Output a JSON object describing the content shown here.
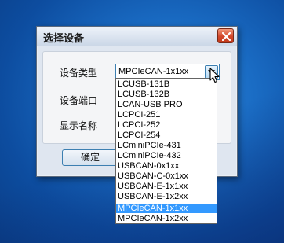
{
  "dialog": {
    "title": "选择设备",
    "fields": {
      "device_type_label": "设备类型",
      "device_port_label": "设备端口",
      "display_name_label": "显示名称"
    },
    "device_type": {
      "value": "MPCIeCAN-1x1xx",
      "options": [
        "LCUSB-131B",
        "LCUSB-132B",
        "LCAN-USB PRO",
        "LCPCI-251",
        "LCPCI-252",
        "LCPCI-254",
        "LCminiPCIe-431",
        "LCminiPCIe-432",
        "USBCAN-0x1xx",
        "USBCAN-C-0x1xx",
        "USBCAN-E-1x1xx",
        "USBCAN-E-1x2xx",
        "MPCIeCAN-1x1xx",
        "MPCIeCAN-1x2xx"
      ],
      "highlighted": "MPCIeCAN-1x1xx"
    },
    "ok_label": "确定"
  },
  "colors": {
    "selection": "#3399ff",
    "close_button": "#d2472b",
    "desktop": "#1a6cc4"
  },
  "icons": [
    "close-icon",
    "chevron-down-icon",
    "mouse-cursor-icon"
  ]
}
